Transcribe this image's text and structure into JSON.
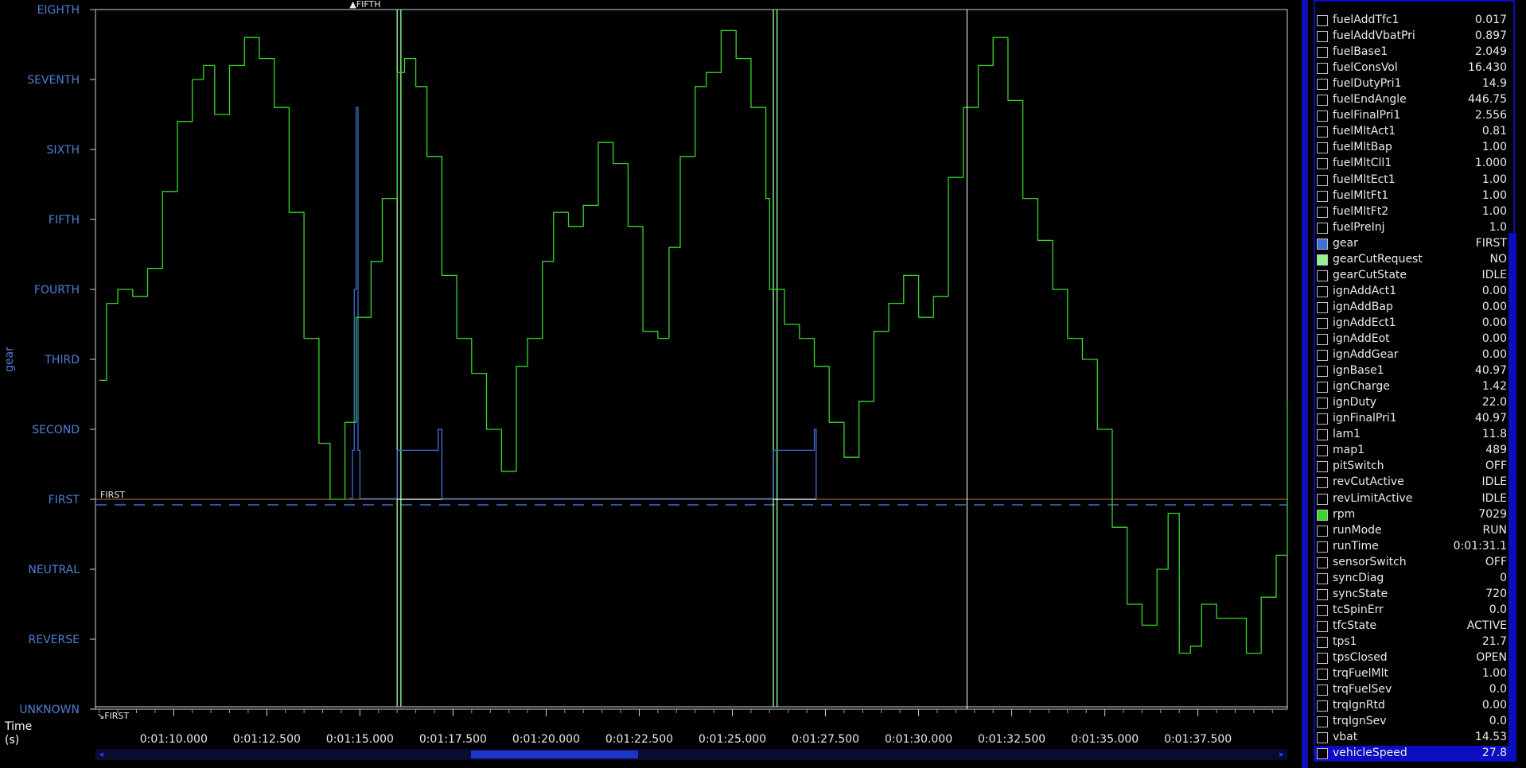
{
  "plot": {
    "y_axis_label": "gear",
    "y_categories": [
      "UNKNOWN",
      "REVERSE",
      "NEUTRAL",
      "FIRST",
      "SECOND",
      "THIRD",
      "FOURTH",
      "FIFTH",
      "SIXTH",
      "SEVENTH",
      "EIGHTH"
    ],
    "x_ticks": [
      "0:01:10.000",
      "0:01:12.500",
      "0:01:15.000",
      "0:01:17.500",
      "0:01:20.000",
      "0:01:22.500",
      "0:01:25.000",
      "0:01:27.500",
      "0:01:30.000",
      "0:01:32.500",
      "0:01:35.000",
      "0:01:37.500"
    ],
    "x_axis_label_line1": "Time",
    "x_axis_label_line2": "(s)",
    "marker_top": "FIFTH",
    "cursor_label": "FIRST",
    "bottom_marker": "FIRST",
    "colors": {
      "rpm_trace": "#38d62b",
      "gear_trace": "#3f6fd8",
      "gear_cut_trace": "#8ef58e",
      "axis_label": "#4f7fd6",
      "reference_line": "#c9773a",
      "cursor": "#ffffff"
    }
  },
  "chart_data": {
    "type": "line",
    "xlabel": "Time (s)",
    "ylabel": "gear",
    "xlim": [
      67.9,
      99.9
    ],
    "y_categories": [
      "UNKNOWN",
      "REVERSE",
      "NEUTRAL",
      "FIRST",
      "SECOND",
      "THIRD",
      "FOURTH",
      "FIFTH",
      "SIXTH",
      "SEVENTH",
      "EIGHTH"
    ],
    "cursor_time": 91.3,
    "series": [
      {
        "name": "rpm",
        "x": [
          68.0,
          68.2,
          68.5,
          68.9,
          69.3,
          69.7,
          70.1,
          70.5,
          70.8,
          71.1,
          71.5,
          71.9,
          72.3,
          72.7,
          73.1,
          73.5,
          73.9,
          74.2,
          74.6,
          74.9,
          75.3,
          75.6,
          76.0,
          76.2,
          76.5,
          76.8,
          77.2,
          77.6,
          78.0,
          78.4,
          78.8,
          79.2,
          79.5,
          79.9,
          80.2,
          80.6,
          81.0,
          81.4,
          81.8,
          82.2,
          82.6,
          83.0,
          83.3,
          83.6,
          84.0,
          84.3,
          84.7,
          85.1,
          85.5,
          85.9,
          86.0,
          86.4,
          86.8,
          87.2,
          87.6,
          88.0,
          88.4,
          88.8,
          89.2,
          89.6,
          90.0,
          90.4,
          90.8,
          91.2,
          91.6,
          92.0,
          92.4,
          92.8,
          93.2,
          93.6,
          94.0,
          94.4,
          94.8,
          95.2,
          95.6,
          96.0,
          96.4,
          96.7,
          97.0,
          97.3,
          97.6,
          98.0,
          98.4,
          98.8,
          99.2,
          99.6,
          99.9
        ],
        "y": [
          4.7,
          5.8,
          6.0,
          5.9,
          6.3,
          7.4,
          8.4,
          9.0,
          9.2,
          8.5,
          9.2,
          9.6,
          9.3,
          8.6,
          7.1,
          5.3,
          3.8,
          3.0,
          4.1,
          5.6,
          6.4,
          7.3,
          9.1,
          9.3,
          8.9,
          7.9,
          6.2,
          5.3,
          4.8,
          4.0,
          3.4,
          4.9,
          5.3,
          6.4,
          7.1,
          6.9,
          7.2,
          8.1,
          7.8,
          6.9,
          5.4,
          5.3,
          6.6,
          7.9,
          8.9,
          9.1,
          9.7,
          9.3,
          8.6,
          7.3,
          6.0,
          5.5,
          5.3,
          4.9,
          4.1,
          3.6,
          4.4,
          5.4,
          5.8,
          6.2,
          5.6,
          5.9,
          7.6,
          8.6,
          9.2,
          9.6,
          8.7,
          7.3,
          6.7,
          6.0,
          5.3,
          5.0,
          4.0,
          2.6,
          1.5,
          1.2,
          2.0,
          2.8,
          0.8,
          0.9,
          1.5,
          1.3,
          1.3,
          0.8,
          1.6,
          2.2,
          4.4
        ]
      },
      {
        "name": "gear",
        "x": [
          74.7,
          74.8,
          74.8,
          74.85,
          74.85,
          74.9,
          74.9,
          74.95,
          74.95,
          75.0,
          75.0,
          76.0,
          76.0,
          77.1,
          77.1,
          77.2,
          77.2,
          86.1,
          86.1,
          87.2,
          87.2,
          87.25,
          87.25
        ],
        "y": [
          0.01,
          0.01,
          0.7,
          0.7,
          3.0,
          3.0,
          5.6,
          5.6,
          0.7,
          0.7,
          0.01,
          0.01,
          0.7,
          0.7,
          1.0,
          1.0,
          0.01,
          0.01,
          0.7,
          0.7,
          1.0,
          1.0,
          0.01
        ]
      },
      {
        "name": "gearCutRequest",
        "x": [
          67.9,
          76.0,
          76.0,
          76.1,
          76.1,
          86.1,
          86.1,
          86.2,
          86.2,
          99.9
        ],
        "y": [
          -3.0,
          -3.0,
          7.0,
          7.0,
          -3.0,
          -3.0,
          7.0,
          7.0,
          -3.0,
          -3.0
        ]
      }
    ]
  },
  "channels": [
    {
      "name": "fuelAddTfc1",
      "value": "0.017",
      "color": ""
    },
    {
      "name": "fuelAddVbatPri",
      "value": "0.897",
      "color": ""
    },
    {
      "name": "fuelBase1",
      "value": "2.049",
      "color": ""
    },
    {
      "name": "fuelConsVol",
      "value": "16.430",
      "color": ""
    },
    {
      "name": "fuelDutyPri1",
      "value": "14.9",
      "color": ""
    },
    {
      "name": "fuelEndAngle",
      "value": "446.75",
      "color": ""
    },
    {
      "name": "fuelFinalPri1",
      "value": "2.556",
      "color": ""
    },
    {
      "name": "fuelMltAct1",
      "value": "0.81",
      "color": ""
    },
    {
      "name": "fuelMltBap",
      "value": "1.00",
      "color": ""
    },
    {
      "name": "fuelMltCll1",
      "value": "1.000",
      "color": ""
    },
    {
      "name": "fuelMltEct1",
      "value": "1.00",
      "color": ""
    },
    {
      "name": "fuelMltFt1",
      "value": "1.00",
      "color": ""
    },
    {
      "name": "fuelMltFt2",
      "value": "1.00",
      "color": ""
    },
    {
      "name": "fuelPreInj",
      "value": "1.0",
      "color": ""
    },
    {
      "name": "gear",
      "value": "FIRST",
      "color": "#3f6fd8"
    },
    {
      "name": "gearCutRequest",
      "value": "NO",
      "color": "#8ef58e"
    },
    {
      "name": "gearCutState",
      "value": "IDLE",
      "color": ""
    },
    {
      "name": "ignAddAct1",
      "value": "0.00",
      "color": ""
    },
    {
      "name": "ignAddBap",
      "value": "0.00",
      "color": ""
    },
    {
      "name": "ignAddEct1",
      "value": "0.00",
      "color": ""
    },
    {
      "name": "ignAddEot",
      "value": "0.00",
      "color": ""
    },
    {
      "name": "ignAddGear",
      "value": "0.00",
      "color": ""
    },
    {
      "name": "ignBase1",
      "value": "40.97",
      "color": ""
    },
    {
      "name": "ignCharge",
      "value": "1.42",
      "color": ""
    },
    {
      "name": "ignDuty",
      "value": "22.0",
      "color": ""
    },
    {
      "name": "ignFinalPri1",
      "value": "40.97",
      "color": ""
    },
    {
      "name": "lam1",
      "value": "11.8",
      "color": ""
    },
    {
      "name": "map1",
      "value": "489",
      "color": ""
    },
    {
      "name": "pitSwitch",
      "value": "OFF",
      "color": ""
    },
    {
      "name": "revCutActive",
      "value": "IDLE",
      "color": ""
    },
    {
      "name": "revLimitActive",
      "value": "IDLE",
      "color": ""
    },
    {
      "name": "rpm",
      "value": "7029",
      "color": "#38d62b"
    },
    {
      "name": "runMode",
      "value": "RUN",
      "color": ""
    },
    {
      "name": "runTime",
      "value": "0:01:31.1",
      "color": ""
    },
    {
      "name": "sensorSwitch",
      "value": "OFF",
      "color": ""
    },
    {
      "name": "syncDiag",
      "value": "0",
      "color": ""
    },
    {
      "name": "syncState",
      "value": "720",
      "color": ""
    },
    {
      "name": "tcSpinErr",
      "value": "0.0",
      "color": ""
    },
    {
      "name": "tfcState",
      "value": "ACTIVE",
      "color": ""
    },
    {
      "name": "tps1",
      "value": "21.7",
      "color": ""
    },
    {
      "name": "tpsClosed",
      "value": "OPEN",
      "color": ""
    },
    {
      "name": "trqFuelMlt",
      "value": "1.00",
      "color": ""
    },
    {
      "name": "trqFuelSev",
      "value": "0.0",
      "color": ""
    },
    {
      "name": "trqIgnRtd",
      "value": "0.00",
      "color": ""
    },
    {
      "name": "trqIgnSev",
      "value": "0.0",
      "color": ""
    },
    {
      "name": "vbat",
      "value": "14.53",
      "color": ""
    },
    {
      "name": "vehicleSpeed",
      "value": "27.8",
      "color": "",
      "selected": true
    }
  ],
  "scrollbar": {
    "left_arrow": "◂",
    "right_arrow": "▸"
  }
}
